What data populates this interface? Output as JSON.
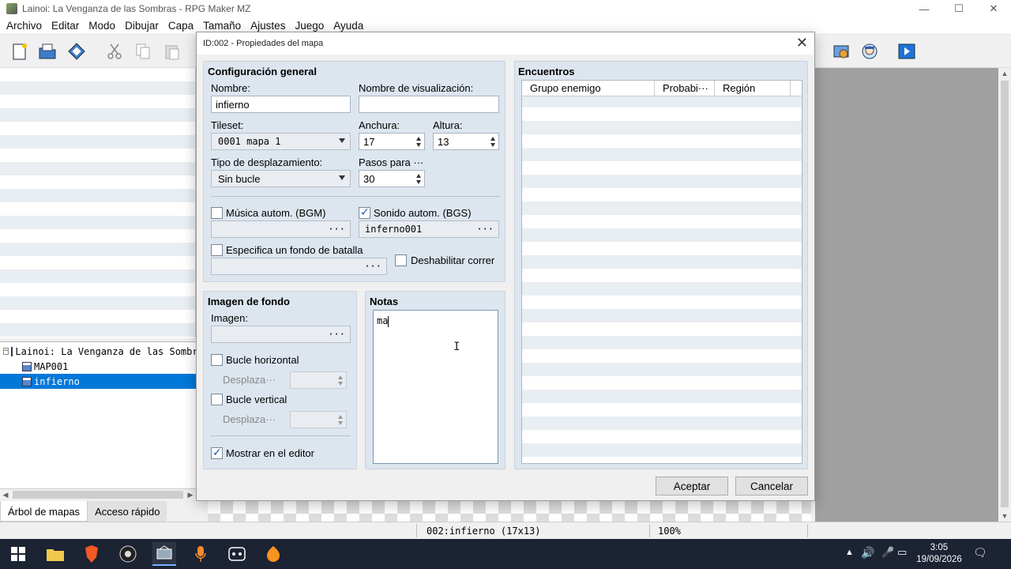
{
  "window": {
    "title": "Lainoi: La Venganza de las Sombras - RPG Maker MZ"
  },
  "menu": [
    "Archivo",
    "Editar",
    "Modo",
    "Dibujar",
    "Capa",
    "Tamaño",
    "Ajustes",
    "Juego",
    "Ayuda"
  ],
  "tree": {
    "project": "Lainoi: La Venganza de las Sombras",
    "maps": [
      "MAP001",
      "infierno"
    ],
    "selected": "infierno"
  },
  "bottom_tabs": {
    "tree": "Árbol de mapas",
    "quick": "Acceso rápido"
  },
  "status": {
    "map": "002:infierno (17x13)",
    "zoom": "100%"
  },
  "dialog": {
    "title": "ID:002 - Propiedades del mapa",
    "general": {
      "title": "Configuración general",
      "name_label": "Nombre:",
      "name_value": "infierno",
      "display_label": "Nombre de visualización:",
      "display_value": "",
      "tileset_label": "Tileset:",
      "tileset_value": "0001 mapa 1",
      "width_label": "Anchura:",
      "width_value": "17",
      "height_label": "Altura:",
      "height_value": "13",
      "scroll_label": "Tipo de desplazamiento:",
      "scroll_value": "Sin bucle",
      "steps_label": "Pasos para ···",
      "steps_value": "30",
      "bgm_label": "Música autom. (BGM)",
      "bgm_checked": false,
      "bgm_value": "",
      "bgs_label": "Sonido autom. (BGS)",
      "bgs_checked": true,
      "bgs_value": "inferno001",
      "battleback_label": "Especifica un fondo de batalla",
      "battleback_checked": false,
      "battleback_value": "",
      "disable_dash_label": "Deshabilitar correr",
      "disable_dash_checked": false
    },
    "parallax": {
      "title": "Imagen de fondo",
      "image_label": "Imagen:",
      "image_value": "",
      "loop_h_label": "Bucle horizontal",
      "loop_h_checked": false,
      "scroll_h_label": "Desplaza···",
      "loop_v_label": "Bucle vertical",
      "loop_v_checked": false,
      "scroll_v_label": "Desplaza···",
      "show_editor_label": "Mostrar en el editor",
      "show_editor_checked": true
    },
    "notes": {
      "title": "Notas",
      "value": "ma"
    },
    "encounters": {
      "title": "Encuentros",
      "columns": [
        "Grupo enemigo",
        "Probabi···",
        "Región"
      ]
    },
    "ok_label": "Aceptar",
    "cancel_label": "Cancelar"
  },
  "taskbar": {
    "time": "3:05",
    "date": "19/09/2026"
  }
}
